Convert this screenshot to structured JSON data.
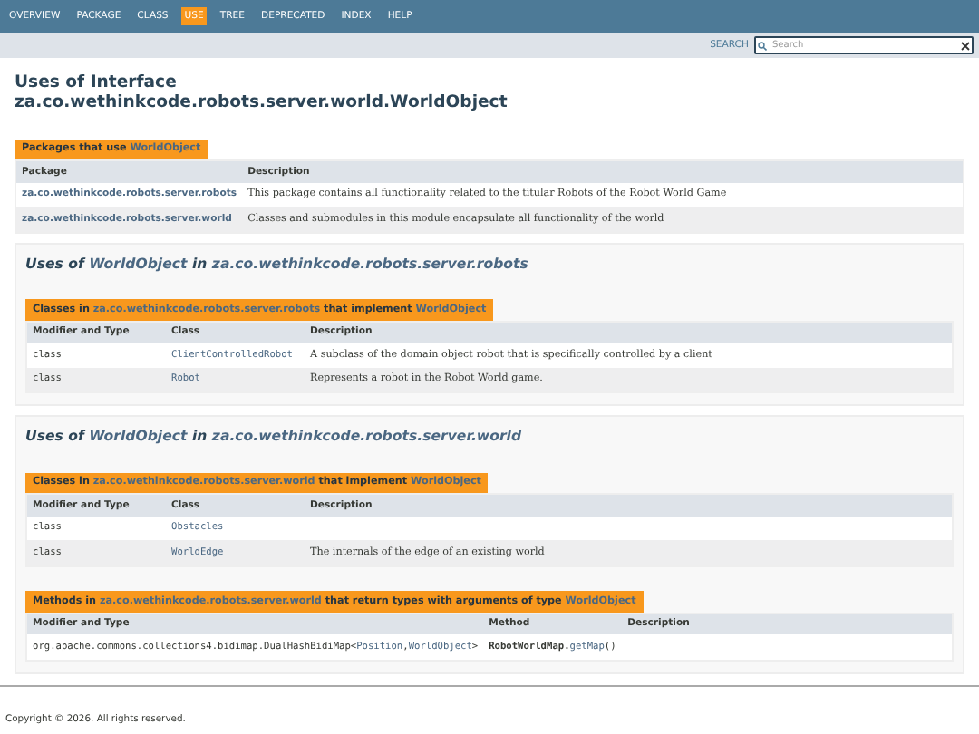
{
  "nav": {
    "items": [
      {
        "label": "OVERVIEW",
        "selected": false
      },
      {
        "label": "PACKAGE",
        "selected": false
      },
      {
        "label": "CLASS",
        "selected": false
      },
      {
        "label": "USE",
        "selected": true
      },
      {
        "label": "TREE",
        "selected": false
      },
      {
        "label": "DEPRECATED",
        "selected": false
      },
      {
        "label": "INDEX",
        "selected": false
      },
      {
        "label": "HELP",
        "selected": false
      }
    ]
  },
  "search": {
    "label": "SEARCH",
    "placeholder": "Search"
  },
  "title": {
    "line_1": "Uses of Interface",
    "line_2": "za.co.wethinkcode.robots.server.world.WorldObject"
  },
  "summary_table": {
    "caption": [
      {
        "text": "Packages that use ",
        "kind": "plain"
      },
      {
        "text": "WorldObject",
        "kind": "link"
      }
    ],
    "columns": [
      "Package",
      "Description"
    ],
    "rows": [
      [
        {
          "kind": "sans",
          "parts": [
            {
              "text": "za.co.wethinkcode.robots.server.robots",
              "kind": "link"
            }
          ]
        },
        {
          "kind": "serif",
          "parts": [
            {
              "text": "This package contains all functionality related to the titular Robots of the Robot World Game",
              "kind": "plain"
            }
          ]
        }
      ],
      [
        {
          "kind": "sans",
          "parts": [
            {
              "text": "za.co.wethinkcode.robots.server.world",
              "kind": "link"
            }
          ]
        },
        {
          "kind": "serif",
          "parts": [
            {
              "text": "Classes and submodules in this module encapsulate all functionality of the world",
              "kind": "plain"
            }
          ]
        }
      ]
    ]
  },
  "sections": [
    {
      "heading": [
        {
          "text": "Uses of ",
          "kind": "plain"
        },
        {
          "text": "WorldObject",
          "kind": "link"
        },
        {
          "text": " in ",
          "kind": "plain"
        },
        {
          "text": "za.co.wethinkcode.robots.server.robots",
          "kind": "link"
        }
      ],
      "tables": [
        {
          "caption": [
            {
              "text": "Classes in ",
              "kind": "plain"
            },
            {
              "text": "za.co.wethinkcode.robots.server.robots",
              "kind": "link"
            },
            {
              "text": " that implement ",
              "kind": "plain"
            },
            {
              "text": "WorldObject",
              "kind": "link"
            }
          ],
          "columns": [
            "Modifier and Type",
            "Class",
            "Description"
          ],
          "rows": [
            [
              {
                "kind": "mono",
                "parts": [
                  {
                    "text": "class",
                    "kind": "plain"
                  }
                ]
              },
              {
                "kind": "mono",
                "parts": [
                  {
                    "text": "ClientControlledRobot",
                    "kind": "link"
                  }
                ]
              },
              {
                "kind": "serif",
                "parts": [
                  {
                    "text": "A subclass of the domain object robot that is specifically controlled by a client",
                    "kind": "plain"
                  }
                ]
              }
            ],
            [
              {
                "kind": "mono",
                "parts": [
                  {
                    "text": "class",
                    "kind": "plain"
                  }
                ]
              },
              {
                "kind": "mono",
                "parts": [
                  {
                    "text": "Robot",
                    "kind": "link"
                  }
                ]
              },
              {
                "kind": "serif",
                "parts": [
                  {
                    "text": "Represents a robot in the Robot World game.",
                    "kind": "plain"
                  }
                ]
              }
            ]
          ]
        }
      ]
    },
    {
      "heading": [
        {
          "text": "Uses of ",
          "kind": "plain"
        },
        {
          "text": "WorldObject",
          "kind": "link"
        },
        {
          "text": " in ",
          "kind": "plain"
        },
        {
          "text": "za.co.wethinkcode.robots.server.world",
          "kind": "link"
        }
      ],
      "tables": [
        {
          "caption": [
            {
              "text": "Classes in ",
              "kind": "plain"
            },
            {
              "text": "za.co.wethinkcode.robots.server.world",
              "kind": "link"
            },
            {
              "text": " that implement ",
              "kind": "plain"
            },
            {
              "text": "WorldObject",
              "kind": "link"
            }
          ],
          "columns": [
            "Modifier and Type",
            "Class",
            "Description"
          ],
          "rows": [
            [
              {
                "kind": "mono",
                "parts": [
                  {
                    "text": "class",
                    "kind": "plain"
                  }
                ]
              },
              {
                "kind": "mono",
                "parts": [
                  {
                    "text": "Obstacles",
                    "kind": "link"
                  }
                ]
              },
              {
                "kind": "serif"
              }
            ],
            [
              {
                "kind": "mono",
                "parts": [
                  {
                    "text": "class",
                    "kind": "plain"
                  }
                ]
              },
              {
                "kind": "mono",
                "parts": [
                  {
                    "text": "WorldEdge",
                    "kind": "link"
                  }
                ]
              },
              {
                "kind": "serif",
                "parts": [
                  {
                    "text": "The internals of the edge of an existing world",
                    "kind": "plain"
                  }
                ]
              }
            ]
          ]
        },
        {
          "caption": [
            {
              "text": "Methods in ",
              "kind": "plain"
            },
            {
              "text": "za.co.wethinkcode.robots.server.world",
              "kind": "link"
            },
            {
              "text": " that return types with arguments of type ",
              "kind": "plain"
            },
            {
              "text": "WorldObject",
              "kind": "link"
            }
          ],
          "columns": [
            "Modifier and Type",
            "Method",
            "Description"
          ],
          "rows": [
            [
              {
                "kind": "mono",
                "parts": [
                  {
                    "text": "org.apache.commons.collections4.bidimap.DualHashBidiMap<",
                    "kind": "plain"
                  },
                  {
                    "text": "Position",
                    "kind": "link"
                  },
                  {
                    "text": ",",
                    "kind": "plain"
                  },
                  {
                    "text": "WorldObject",
                    "kind": "link"
                  },
                  {
                    "text": ">",
                    "kind": "plain"
                  }
                ]
              },
              {
                "kind": "mono",
                "parts": [
                  {
                    "text": "RobotWorldMap.",
                    "kind": "bold"
                  },
                  {
                    "text": "getMap",
                    "kind": "link"
                  },
                  {
                    "text": "()",
                    "kind": "plain"
                  }
                ]
              },
              {
                "kind": "serif"
              }
            ]
          ]
        }
      ]
    }
  ],
  "footer": {
    "copyright": "Copyright © 2026. All rights reserved."
  }
}
